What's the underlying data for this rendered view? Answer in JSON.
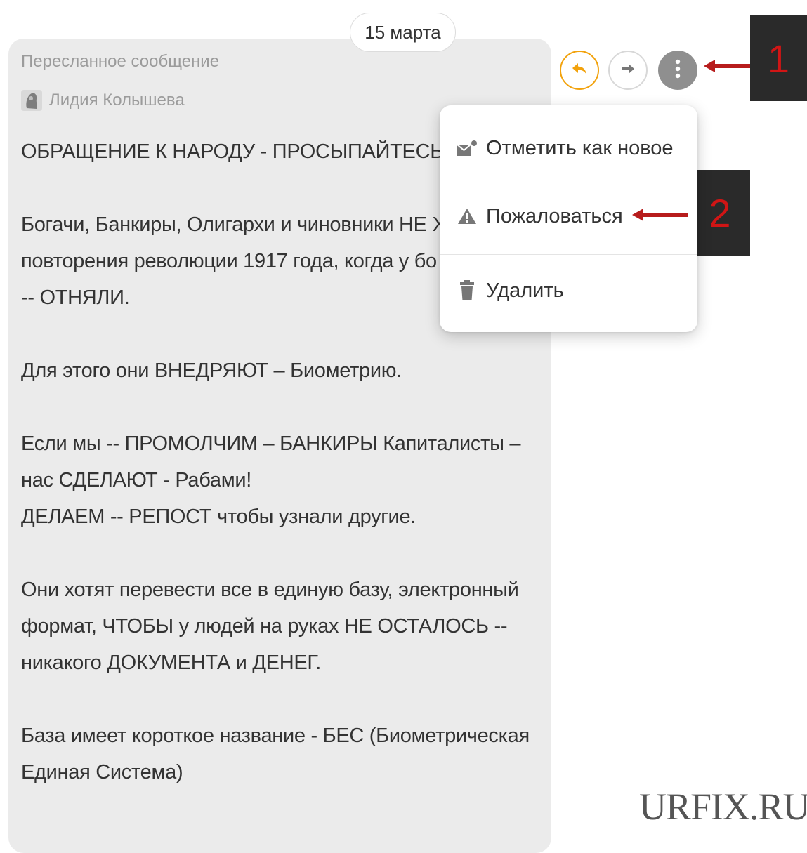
{
  "date": "15 марта",
  "message": {
    "forwarded_label": "Пересланное сообщение",
    "author": "Лидия Колышева",
    "paragraphs": [
      [
        "ОБРАЩЕНИЕ К НАРОДУ - ПРОСЫПАЙТЕСЬ"
      ],
      [
        "Богачи, Банкиры, Олигархи и чиновники НЕ Х",
        "повторения революции 1917 года, когда у бо",
        "-- ОТНЯЛИ."
      ],
      [
        "Для этого они ВНЕДРЯЮТ – Биометрию."
      ],
      [
        "Если мы -- ПРОМОЛЧИМ – БАНКИРЫ Капиталисты –",
        "нас СДЕЛАЮТ - Рабами!",
        "ДЕЛАЕМ -- РЕПОСТ чтобы узнали другие."
      ],
      [
        "Они хотят перевести все в единую базу, электронный",
        "формат, ЧТОБЫ у людей на руках НЕ ОСТАЛОСЬ --",
        "никакого ДОКУМЕНТА и ДЕНЕГ."
      ],
      [
        "База имеет короткое название - БЕС (Биометрическая",
        "Единая Система)"
      ]
    ]
  },
  "actions": {
    "reply_icon": "reply-arrow-icon",
    "forward_icon": "forward-arrow-icon",
    "more_icon": "vertical-dots-icon"
  },
  "menu": {
    "items": [
      {
        "label": "Отметить как новое",
        "icon": "envelope-new-icon"
      },
      {
        "label": "Пожаловаться",
        "icon": "warning-triangle-icon"
      },
      {
        "label": "Удалить",
        "icon": "trash-icon"
      }
    ]
  },
  "annotations": {
    "badge_1": "1",
    "badge_2": "2"
  },
  "watermark": "URFIX.RU",
  "colors": {
    "accent_orange": "#f2a20c",
    "badge_bg": "#2a2a2a",
    "badge_text": "#d11515",
    "bubble_bg": "#ebebeb"
  }
}
